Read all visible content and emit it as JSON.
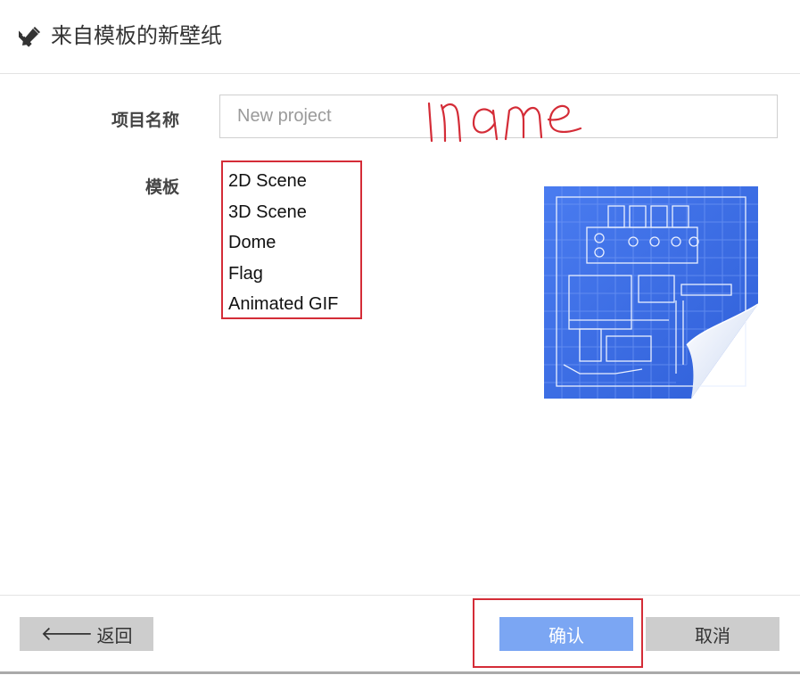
{
  "header": {
    "title": "来自模板的新壁纸",
    "icon": "pencil-ruler-icon"
  },
  "form": {
    "name_label": "项目名称",
    "name_placeholder": "New project",
    "template_label": "模板",
    "templates": [
      {
        "label": "2D Scene"
      },
      {
        "label": "3D Scene"
      },
      {
        "label": "Dome"
      },
      {
        "label": "Flag"
      },
      {
        "label": "Animated GIF"
      }
    ],
    "preview_icon": "blueprint-preview-icon"
  },
  "footer": {
    "back_label": "返回",
    "back_icon": "arrow-left-icon",
    "confirm_label": "确认",
    "cancel_label": "取消"
  },
  "colors": {
    "annotation_red": "#d42c37",
    "confirm_button": "#7ba6f3",
    "secondary_button": "#cdcdcd",
    "blueprint_blue": "#3a6ae0"
  }
}
